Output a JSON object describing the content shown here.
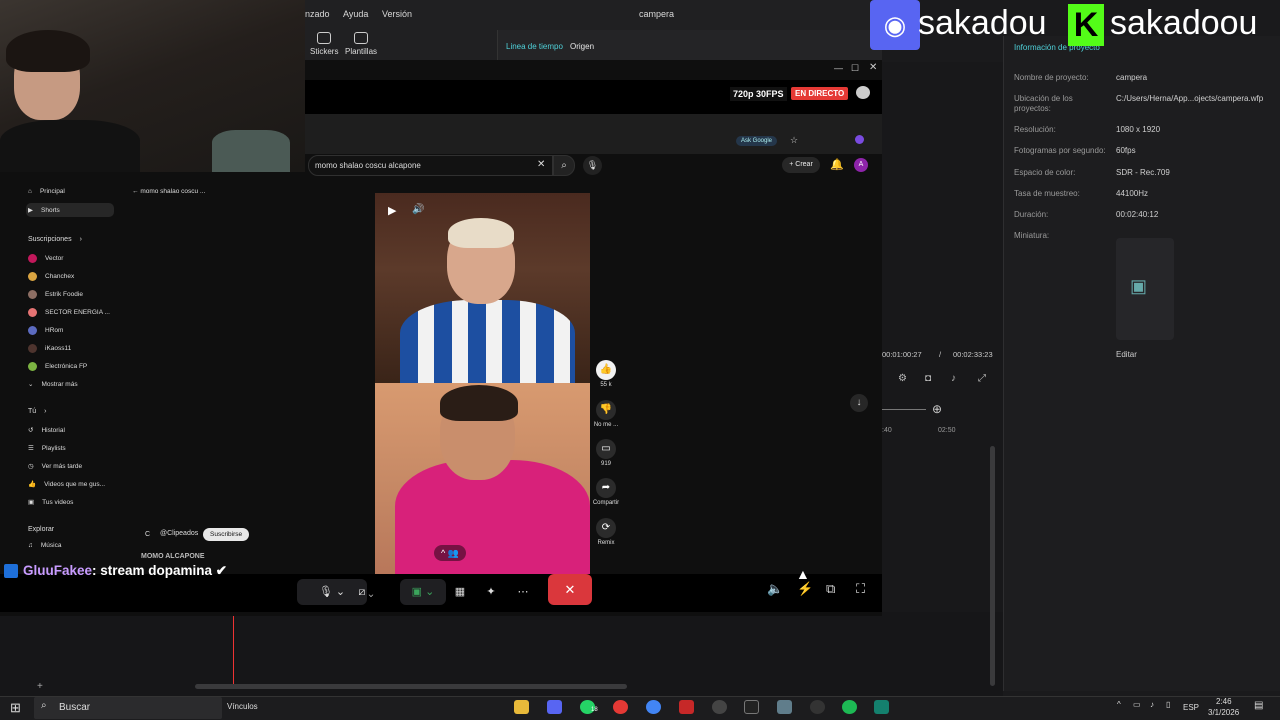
{
  "menu": {
    "item1": "nzado",
    "help": "Ayuda",
    "version": "Versión",
    "title": "campera"
  },
  "tools": {
    "stickers": "Stickers",
    "templates": "Plantillas"
  },
  "panel_tabs": {
    "timeline": "Linea de tiempo",
    "origin": "Origen"
  },
  "project": {
    "header": "Información de proyecto",
    "rows": [
      {
        "label": "Nombre de proyecto:",
        "value": "campera"
      },
      {
        "label": "Ubicación de los proyectos:",
        "value": "C:/Users/Herna/App...ojects/campera.wfp"
      },
      {
        "label": "Resolución:",
        "value": "1080 x 1920"
      },
      {
        "label": "Fotogramas por segundo:",
        "value": "60fps"
      },
      {
        "label": "Espacio de color:",
        "value": "SDR - Rec.709"
      },
      {
        "label": "Tasa de muestreo:",
        "value": "44100Hz"
      },
      {
        "label": "Duración:",
        "value": "00:02:40:12"
      },
      {
        "label": "Miniatura:",
        "value": ""
      }
    ],
    "edit": "Editar"
  },
  "timecodes": {
    "current": "00:01:00:27",
    "sep": "/",
    "total": "00:02:33:23",
    "tick1": ":40",
    "tick2": "02:50"
  },
  "stream": {
    "quality": "720p 30FPS",
    "live": "EN DIRECTO"
  },
  "browser": {
    "ask": "Ask Google",
    "search_value": "momo shalao coscu alcapone",
    "create": "Crear",
    "back_title": "momo shalao coscu ..."
  },
  "sidebar": {
    "home": "Principal",
    "shorts": "Shorts",
    "subs": "Suscripciones",
    "channels": [
      "Vector",
      "Chanchex",
      "Estrik Foodie",
      "SECTOR ENERGIA ...",
      "HRom",
      "iKaoss11",
      "Electrónica FP"
    ],
    "more": "Mostrar más",
    "you": "Tú",
    "history": "Historial",
    "playlists": "Playlists",
    "later": "Ver más tarde",
    "liked": "Videos que me gus...",
    "yours": "Tus videos",
    "explore": "Explorar",
    "music": "Música"
  },
  "video": {
    "likes": "55 k",
    "dislike": "No me ...",
    "comments": "919",
    "share": "Compartir",
    "remix": "Remix",
    "channel": "@Clipeados",
    "subscribe": "Suscribirse",
    "title": "MOMO ALCAPONE"
  },
  "chat": {
    "user": "GluuFakee",
    "message": ": stream dopamina ✔"
  },
  "overlay": {
    "discord": "sakadou",
    "kick": "sakadoou"
  },
  "taskbar": {
    "search": "Buscar",
    "links": "Vínculos",
    "whatsapp_badge": "18",
    "lang": "ESP",
    "time": "2:46",
    "date": "3/1/2026"
  }
}
